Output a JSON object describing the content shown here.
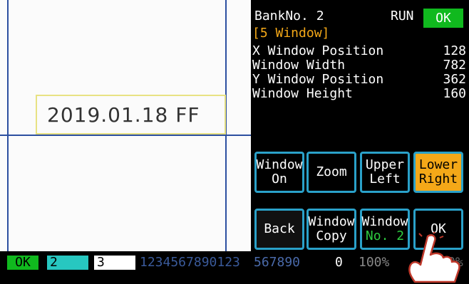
{
  "camera": {
    "ocr_text": "2019.01.18 FF"
  },
  "panel": {
    "bank_label": "BankNo. 2",
    "run_label": "RUN",
    "status_ok": "OK",
    "section_title": "[5 Window]",
    "params": [
      {
        "label": "X Window Position",
        "value": "128"
      },
      {
        "label": "Window Width",
        "value": "782"
      },
      {
        "label": "Y Window Position",
        "value": "362"
      },
      {
        "label": "Window Height",
        "value": "160"
      }
    ],
    "buttons_row1": [
      {
        "line1": "Window",
        "line2": "On"
      },
      {
        "line1": "Zoom",
        "line2": ""
      },
      {
        "line1": "Upper",
        "line2": "Left"
      },
      {
        "line1": "Lower",
        "line2": "Right"
      }
    ],
    "buttons_row2": [
      {
        "line1": "Back",
        "line2": ""
      },
      {
        "line1": "Window",
        "line2": "Copy"
      },
      {
        "line1": "Window",
        "line2": "No. 2"
      },
      {
        "line1": "OK",
        "line2": ""
      }
    ]
  },
  "statusbar": {
    "ok": "OK",
    "slot2": "2",
    "slot3": "3",
    "digits": "1234567890123",
    "digits2": "567890",
    "count": "0",
    "percent": "100%",
    "tail": "0%"
  },
  "colors": {
    "accent_blue": "#2aa1c9",
    "ok_green": "#10b91e",
    "orange": "#f4a818",
    "crosshair": "#2c4fa0"
  }
}
